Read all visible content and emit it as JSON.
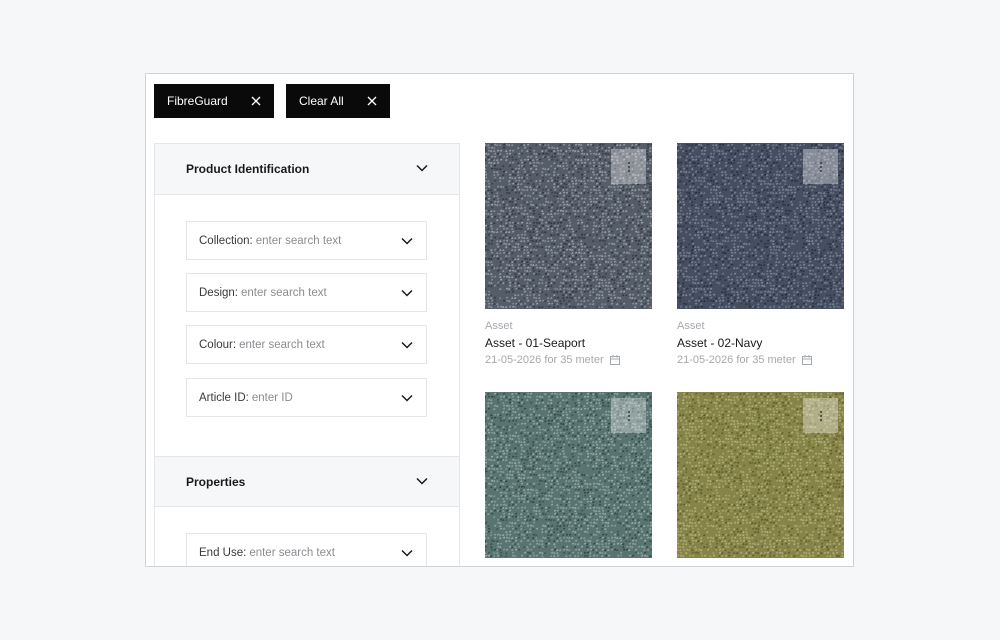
{
  "filters": {
    "chips": [
      {
        "label": "FibreGuard"
      },
      {
        "label": "Clear All"
      }
    ]
  },
  "sidebar": {
    "sections": [
      {
        "title": "Product Identification",
        "fields": [
          {
            "label": "Collection:",
            "placeholder": "enter search text"
          },
          {
            "label": "Design:",
            "placeholder": "enter search text"
          },
          {
            "label": "Colour:",
            "placeholder": "enter search text"
          },
          {
            "label": "Article ID:",
            "placeholder": "enter ID"
          }
        ]
      },
      {
        "title": "Properties",
        "fields": [
          {
            "label": "End Use:",
            "placeholder": "enter search text"
          }
        ]
      }
    ]
  },
  "assets": [
    {
      "type": "Asset",
      "name": "Asset - 01-Seaport",
      "date": "21-05-2026 for 35 meter",
      "colors": {
        "base": "#5b6470",
        "light": "#aab2bb",
        "dark": "#2f353d"
      }
    },
    {
      "type": "Asset",
      "name": "Asset - 02-Navy",
      "date": "21-05-2026 for 35 meter",
      "colors": {
        "base": "#4a5567",
        "light": "#8b97a8",
        "dark": "#262d38"
      }
    },
    {
      "type": "",
      "name": "",
      "date": "",
      "colors": {
        "base": "#5f7c78",
        "light": "#a7bfbb",
        "dark": "#33453f"
      }
    },
    {
      "type": "",
      "name": "",
      "date": "",
      "colors": {
        "base": "#8c8a4e",
        "light": "#c3c184",
        "dark": "#5a5a2c"
      }
    }
  ],
  "icons": {
    "chip_close": "close-icon",
    "section_toggle": "chevron-down-icon",
    "field_dropdown": "chevron-down-icon",
    "asset_menu": "kebab-menu-icon",
    "date": "calendar-icon"
  }
}
